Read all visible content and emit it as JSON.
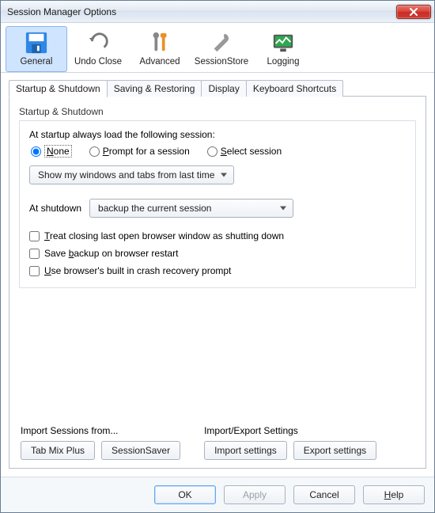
{
  "window_title": "Session Manager Options",
  "main_tabs": {
    "general": "General",
    "undo_close": "Undo Close",
    "advanced": "Advanced",
    "session_store": "SessionStore",
    "logging": "Logging"
  },
  "inner_tabs": {
    "startup_shutdown": "Startup & Shutdown",
    "saving_restoring": "Saving & Restoring",
    "display": "Display",
    "keyboard": "Keyboard Shortcuts"
  },
  "group": {
    "title": "Startup & Shutdown",
    "startup_text": "At startup always load the following session:",
    "radio_none_first": "N",
    "radio_none_rest": "one",
    "radio_prompt_first": "P",
    "radio_prompt_rest": "rompt for a session",
    "radio_select_first": "S",
    "radio_select_rest": "elect session",
    "startup_dropdown": "Show my windows and tabs from last time",
    "shutdown_label": "At shutdown",
    "shutdown_dropdown": "backup the current session",
    "check1_first": "T",
    "check1_rest": "reat closing last open browser window as shutting down",
    "check2_text_a": "Save ",
    "check2_first": "b",
    "check2_rest": "ackup on browser restart",
    "check3_first": "U",
    "check3_rest": "se browser's built in crash recovery prompt"
  },
  "import_sessions": {
    "title": "Import Sessions from...",
    "tabmix": "Tab Mix Plus",
    "sessionsaver": "SessionSaver"
  },
  "import_export": {
    "title": "Import/Export Settings",
    "import": "Import settings",
    "export": "Export settings"
  },
  "footer": {
    "ok": "OK",
    "apply": "Apply",
    "cancel": "Cancel",
    "help_first": "H",
    "help_rest": "elp"
  }
}
